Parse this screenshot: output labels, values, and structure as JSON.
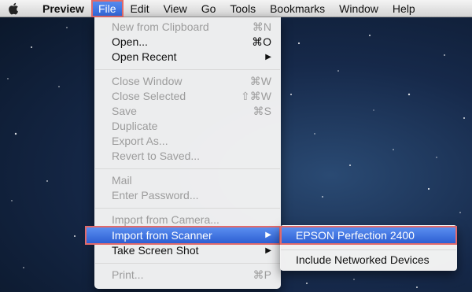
{
  "menubar": {
    "app_name": "Preview",
    "menus": [
      "File",
      "Edit",
      "View",
      "Go",
      "Tools",
      "Bookmarks",
      "Window",
      "Help"
    ],
    "active_menu": "File"
  },
  "file_menu": {
    "new_from_clipboard": {
      "label": "New from Clipboard",
      "shortcut": "⌘N"
    },
    "open": {
      "label": "Open...",
      "shortcut": "⌘O"
    },
    "open_recent": {
      "label": "Open Recent"
    },
    "close_window": {
      "label": "Close Window",
      "shortcut": "⌘W"
    },
    "close_selected": {
      "label": "Close Selected",
      "shortcut": "⇧⌘W"
    },
    "save": {
      "label": "Save",
      "shortcut": "⌘S"
    },
    "duplicate": {
      "label": "Duplicate"
    },
    "export_as": {
      "label": "Export As..."
    },
    "revert_to_saved": {
      "label": "Revert to Saved..."
    },
    "mail": {
      "label": "Mail"
    },
    "enter_password": {
      "label": "Enter Password..."
    },
    "import_from_camera": {
      "label": "Import from Camera..."
    },
    "import_from_scanner": {
      "label": "Import from Scanner"
    },
    "take_screen_shot": {
      "label": "Take Screen Shot"
    },
    "print": {
      "label": "Print...",
      "shortcut": "⌘P"
    }
  },
  "scanner_submenu": {
    "epson": "EPSON Perfection 2400",
    "include_networked": "Include Networked Devices"
  },
  "colors": {
    "highlight_blue": "#3a6fe0",
    "annotation_red": "#e26a6a"
  }
}
